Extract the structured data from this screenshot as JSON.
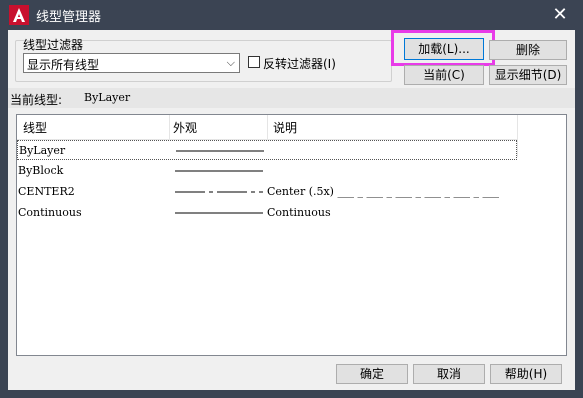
{
  "window": {
    "title": "线型管理器",
    "close_symbol": "✕"
  },
  "filter": {
    "group_label": "线型过滤器",
    "selected": "显示所有线型",
    "invert_label": "反转过滤器(I)",
    "invert_checked": false
  },
  "buttons": {
    "load": "加载(L)...",
    "delete": "删除",
    "current": "当前(C)",
    "details": "显示细节(D)",
    "ok": "确定",
    "cancel": "取消",
    "help": "帮助(H)"
  },
  "current_linetype": {
    "label": "当前线型:",
    "value": "ByLayer"
  },
  "list": {
    "columns": [
      "线型",
      "外观",
      "说明"
    ],
    "rows": [
      {
        "name": "ByLayer",
        "appearance": "continuous",
        "description": ""
      },
      {
        "name": "ByBlock",
        "appearance": "continuous",
        "description": ""
      },
      {
        "name": "CENTER2",
        "appearance": "center",
        "description": "Center (.5x) ___ _ ___ _ ___ _ ___ _ ___ _ ___"
      },
      {
        "name": "Continuous",
        "appearance": "continuous",
        "description": "Continuous"
      }
    ]
  },
  "colors": {
    "title_bg": "#3b4453",
    "highlight": "#e83be8",
    "accent": "#0078d7"
  }
}
